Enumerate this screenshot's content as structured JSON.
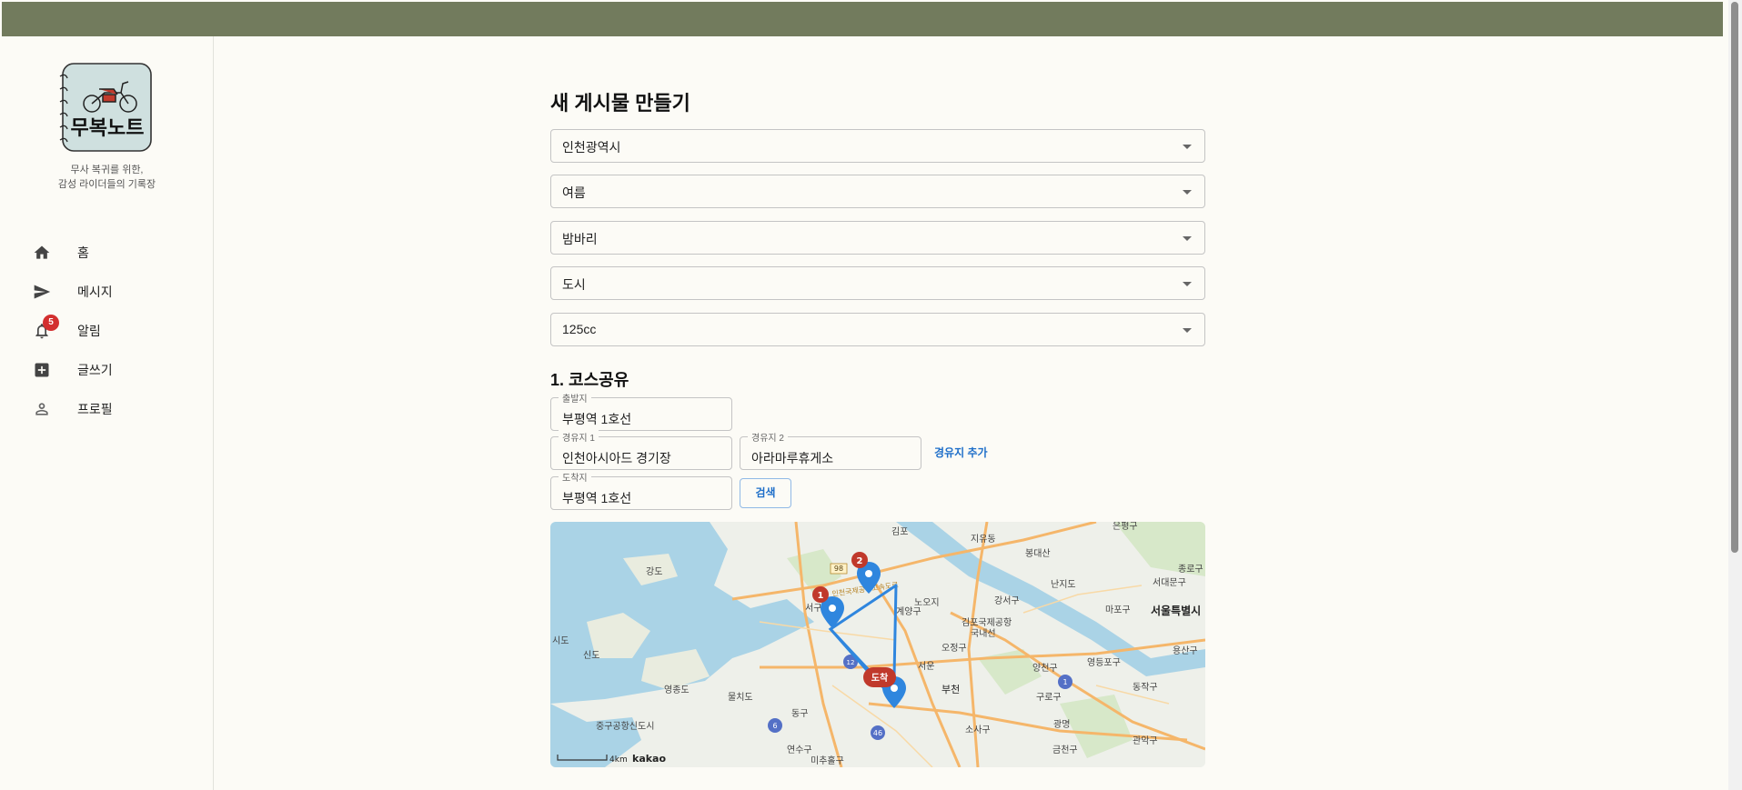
{
  "app": {
    "logo_text": "무복노트",
    "tagline_line1": "무사 복귀를 위한,",
    "tagline_line2": "감성 라이더들의 기록장"
  },
  "nav": {
    "items": [
      {
        "label": "홈",
        "icon": "home-icon"
      },
      {
        "label": "메시지",
        "icon": "send-icon"
      },
      {
        "label": "알림",
        "icon": "bell-icon",
        "badge": "5"
      },
      {
        "label": "글쓰기",
        "icon": "add-box-icon"
      },
      {
        "label": "프로필",
        "icon": "person-icon"
      }
    ]
  },
  "form": {
    "title": "새 게시물 만들기",
    "selects": [
      {
        "value": "인천광역시"
      },
      {
        "value": "여름"
      },
      {
        "value": "밤바리"
      },
      {
        "value": "도시"
      },
      {
        "value": "125cc"
      }
    ]
  },
  "course": {
    "section_title": "1. 코스공유",
    "start_label": "출발지",
    "start_value": "부평역 1호선",
    "waypoint1_label": "경유지 1",
    "waypoint1_value": "인천아시아드 경기장",
    "waypoint2_label": "경유지 2",
    "waypoint2_value": "아라마루휴게소",
    "add_waypoint_label": "경유지 추가",
    "end_label": "도착지",
    "end_value": "부평역 1호선",
    "search_label": "검색"
  },
  "map": {
    "scale_label": "4km",
    "provider": "kakao",
    "arrival_marker": "도착",
    "marker1": "1",
    "marker2": "2",
    "place_labels": {
      "gimpo": "김포",
      "jiyangdong": "지유동",
      "bonghwa": "봉대산",
      "eunpyeong": "은평구",
      "seodaemun": "서대문구",
      "jongno": "종로구",
      "seoul": "서울특별시",
      "yongsan": "용산구",
      "dongjak": "동작구",
      "gwangmyeong": "광명",
      "bucheon": "부천",
      "gyeyang": "계양구",
      "gangseo": "강서구",
      "yangcheon": "양천구",
      "guro": "구로구",
      "sosa": "소사구",
      "geumcheon": "금천구",
      "gwanak": "관악구",
      "yeongdeungpo": "영등포구",
      "mapo": "마포구",
      "nanji": "난지도",
      "gimpo_airport": "김포국제공항",
      "airport_domestic": "국내선",
      "ojeong": "오정구",
      "gangdo": "강도",
      "sindo": "신도",
      "yeongjong": "영종도",
      "mulchi": "물치도",
      "junggu": "중구공항신도시",
      "yeonsu": "연수구",
      "michuhol": "미추홀구",
      "dongu": "동구",
      "seogu": "서구",
      "noo": "노오지",
      "hido": "시도",
      "seowon": "서운",
      "route_road": "인천국제공항고속도로"
    },
    "road_numbers": [
      "98",
      "6",
      "46",
      "1",
      "12"
    ]
  }
}
